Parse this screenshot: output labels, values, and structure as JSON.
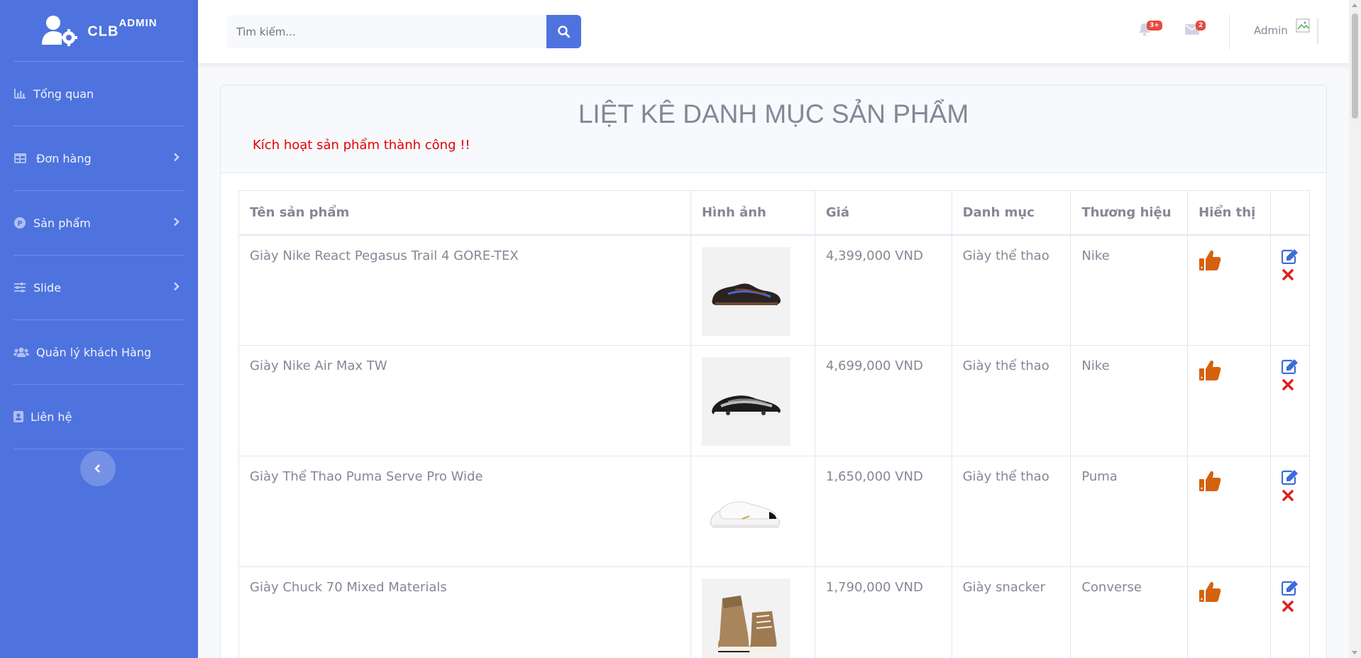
{
  "brand": {
    "name": "CLB",
    "sup": "ADMIN"
  },
  "sidebar": {
    "items": [
      {
        "label": "Tổng quan",
        "icon": "chart-area-icon"
      },
      {
        "label": "Đơn hàng",
        "icon": "table-icon"
      },
      {
        "label": "Sản phẩm",
        "icon": "product-icon"
      },
      {
        "label": "Slide",
        "icon": "sliders-icon"
      },
      {
        "label": "Quản lý khách Hàng",
        "icon": "users-icon"
      },
      {
        "label": "Liên hệ",
        "icon": "contact-icon"
      }
    ]
  },
  "topbar": {
    "search_placeholder": "Tìm kiếm...",
    "alerts_badge": "3+",
    "messages_badge": "2",
    "user_name": "Admin"
  },
  "page": {
    "title": "LIỆT KÊ DANH MỤC SẢN PHẨM",
    "message": "Kích hoạt sản phẩm thành công !!"
  },
  "table": {
    "headers": [
      "Tên sản phẩm",
      "Hình ảnh",
      "Giá",
      "Danh mục",
      "Thương hiệu",
      "Hiển thị",
      ""
    ],
    "rows": [
      {
        "name": "Giày Nike React Pegasus Trail 4 GORE-TEX",
        "price": "4,399,000 VND",
        "category": "Giày thể thao",
        "brand": "Nike",
        "image": "dark-trail-sneaker-image"
      },
      {
        "name": "Giày Nike Air Max TW",
        "price": "4,699,000 VND",
        "category": "Giày thể thao",
        "brand": "Nike",
        "image": "black-white-airmax-image"
      },
      {
        "name": "Giày Thể Thao Puma Serve Pro Wide",
        "price": "1,650,000 VND",
        "category": "Giày thể thao",
        "brand": "Puma",
        "image": "white-puma-sneaker-image"
      },
      {
        "name": "Giày Chuck 70 Mixed Materials",
        "price": "1,790,000 VND",
        "category": "Giày snacker",
        "brand": "Converse",
        "image": "tan-converse-hightop-image"
      }
    ]
  },
  "colors": {
    "primary": "#4e73df",
    "thumb": "#d4620c",
    "edit": "#3b6cd9",
    "delete": "#e02020",
    "message": "#e60000"
  }
}
